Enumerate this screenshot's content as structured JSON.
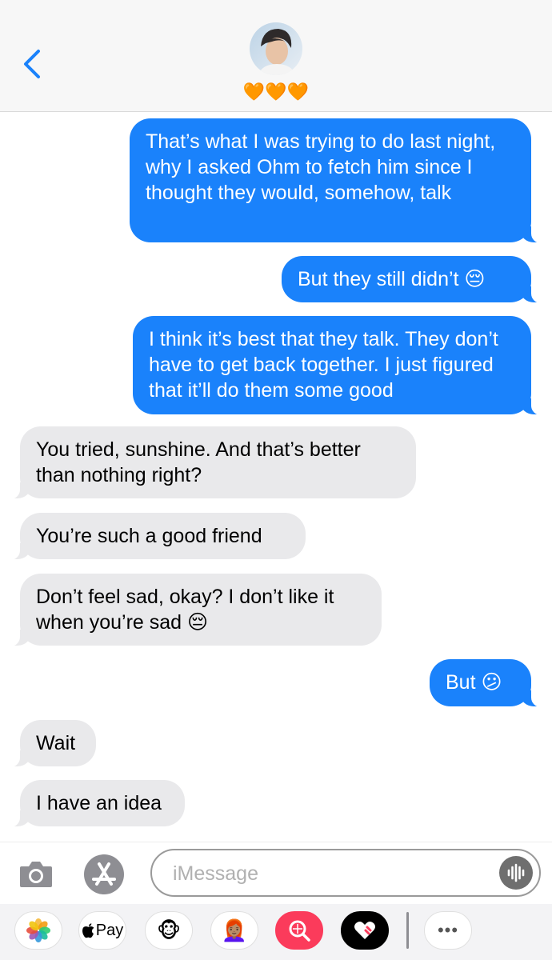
{
  "header": {
    "back_label": "Back",
    "contact_name": "🧡🧡🧡"
  },
  "messages": [
    {
      "side": "sent",
      "text": "That’s what I was trying to do last night, why I asked Ohm to fetch him since I thought they would, somehow, talk"
    },
    {
      "side": "sent",
      "text": "But they still didn’t 😔"
    },
    {
      "side": "sent",
      "text": "I think it’s best that they talk. They don’t have to get back together. I just figured that it’ll do them some good"
    },
    {
      "side": "received",
      "text": "You tried, sunshine. And that’s better than nothing right?"
    },
    {
      "side": "received",
      "text": "You’re such a good friend"
    },
    {
      "side": "received",
      "text": "Don’t feel sad, okay? I don’t like it when you’re sad 😔"
    },
    {
      "side": "sent",
      "text": "But 😕"
    },
    {
      "side": "received",
      "text": "Wait"
    },
    {
      "side": "received",
      "text": "I have an idea"
    }
  ],
  "input": {
    "placeholder": "iMessage"
  },
  "apps": {
    "photos_icon": "photos-icon",
    "applepay_label": "Pay",
    "apple_glyph": "",
    "animoji": "🐵",
    "memoji": "👩🏽‍🦰",
    "search_icon": "images-search-icon",
    "digital_touch_icon": "digital-touch-icon",
    "more_label": "•••"
  },
  "colors": {
    "sent_bubble": "#1a82fb",
    "received_bubble": "#e9e9eb",
    "accent": "#1a82fb"
  }
}
